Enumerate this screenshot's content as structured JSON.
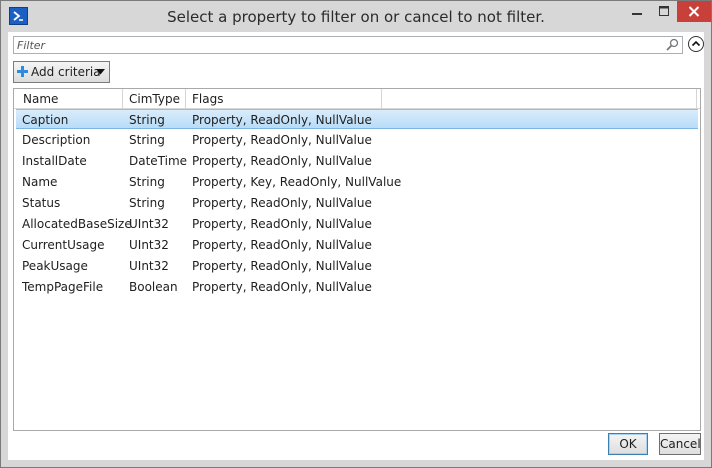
{
  "window": {
    "title": "Select a property to filter on or cancel to not filter.",
    "app_icon": "powershell-icon",
    "controls": [
      "minimize-icon",
      "maximize-icon",
      "close-icon"
    ],
    "close_color": "#c9403a"
  },
  "filter": {
    "placeholder": "Filter",
    "value": "",
    "search_icon": "search-icon",
    "collapse_icon": "chevron-up-circle-icon"
  },
  "add_criteria": {
    "label": "Add criteria",
    "icon": "plus-icon",
    "dropdown_icon": "caret-down-icon"
  },
  "table": {
    "columns": [
      "Name",
      "CimType",
      "Flags"
    ],
    "rows": [
      {
        "name": "Caption",
        "cimtype": "String",
        "flags": "Property, ReadOnly, NullValue",
        "selected": true
      },
      {
        "name": "Description",
        "cimtype": "String",
        "flags": "Property, ReadOnly, NullValue"
      },
      {
        "name": "InstallDate",
        "cimtype": "DateTime",
        "flags": "Property, ReadOnly, NullValue"
      },
      {
        "name": "Name",
        "cimtype": "String",
        "flags": "Property, Key, ReadOnly, NullValue"
      },
      {
        "name": "Status",
        "cimtype": "String",
        "flags": "Property, ReadOnly, NullValue"
      },
      {
        "name": "AllocatedBaseSize",
        "cimtype": "UInt32",
        "flags": "Property, ReadOnly, NullValue"
      },
      {
        "name": "CurrentUsage",
        "cimtype": "UInt32",
        "flags": "Property, ReadOnly, NullValue"
      },
      {
        "name": "PeakUsage",
        "cimtype": "UInt32",
        "flags": "Property, ReadOnly, NullValue"
      },
      {
        "name": "TempPageFile",
        "cimtype": "Boolean",
        "flags": "Property, ReadOnly, NullValue"
      }
    ]
  },
  "buttons": {
    "ok": "OK",
    "cancel": "Cancel"
  }
}
